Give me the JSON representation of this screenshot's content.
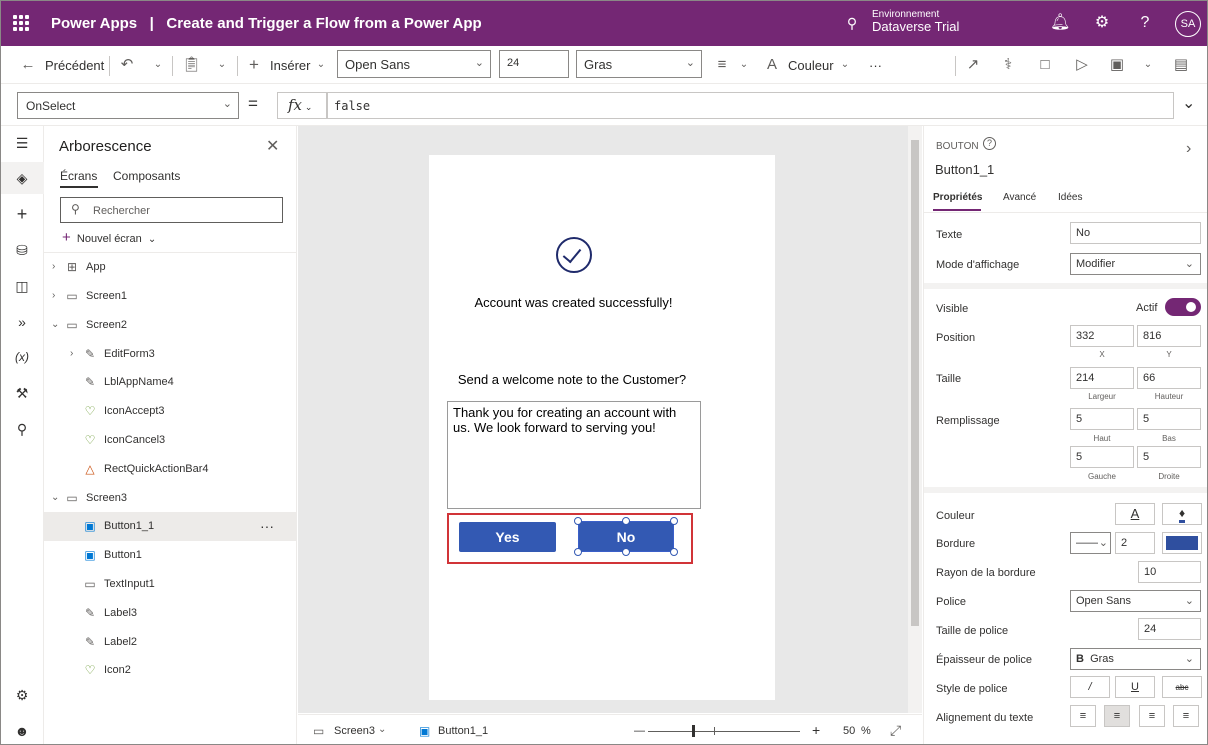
{
  "titlebar": {
    "app_name": "Power Apps",
    "separator": "|",
    "doc_title": "Create and Trigger a Flow from a Power App",
    "env_label": "Environnement",
    "env_name": "Dataverse Trial",
    "avatar": "SA",
    "icons": [
      "waffle-icon",
      "environment-icon",
      "bell-icon",
      "gear-icon",
      "help-icon"
    ]
  },
  "cmdbar": {
    "back_label": "Précédent",
    "insert_label": "Insérer",
    "font_value": "Open Sans",
    "size_value": "24",
    "weight_value": "Gras",
    "color_label": "Couleur",
    "more": "···"
  },
  "formula": {
    "property": "OnSelect",
    "equals": "=",
    "fx": "fx",
    "value": "false"
  },
  "tree": {
    "title": "Arborescence",
    "tab_screens": "Écrans",
    "tab_components": "Composants",
    "search_placeholder": "Rechercher",
    "new_screen": "Nouvel écran",
    "nodes": [
      {
        "label": "App"
      },
      {
        "label": "Screen1"
      },
      {
        "label": "Screen2"
      },
      {
        "label": "EditForm3"
      },
      {
        "label": "LblAppName4"
      },
      {
        "label": "IconAccept3"
      },
      {
        "label": "IconCancel3"
      },
      {
        "label": "RectQuickActionBar4"
      },
      {
        "label": "Screen3"
      },
      {
        "label": "Button1_1"
      },
      {
        "label": "Button1"
      },
      {
        "label": "TextInput1"
      },
      {
        "label": "Label3"
      },
      {
        "label": "Label2"
      },
      {
        "label": "Icon2"
      }
    ]
  },
  "canvas": {
    "success_text": "Account was created successfully!",
    "question_text": "Send a welcome note to the Customer?",
    "note_text": "Thank you for creating an account with us. We look forward to serving you!",
    "yes_label": "Yes",
    "no_label": "No"
  },
  "status": {
    "screen": "Screen3",
    "control": "Button1_1",
    "zoom_minus": "—",
    "zoom_plus": "+",
    "zoom_value": "50",
    "zoom_unit": "%"
  },
  "props": {
    "kind": "BOUTON",
    "name": "Button1_1",
    "tab_properties": "Propriétés",
    "tab_advanced": "Avancé",
    "tab_ideas": "Idées",
    "text_label": "Texte",
    "text_value": "No",
    "display_label": "Mode d'affichage",
    "display_value": "Modifier",
    "visible_label": "Visible",
    "visible_value": "Actif",
    "position_label": "Position",
    "pos_x": "332",
    "pos_y": "816",
    "x_label": "X",
    "y_label": "Y",
    "size_label": "Taille",
    "width": "214",
    "height": "66",
    "width_label": "Largeur",
    "height_label": "Hauteur",
    "padding_label": "Remplissage",
    "pad_top": "5",
    "pad_bottom": "5",
    "pad_left": "5",
    "pad_right": "5",
    "top_label": "Haut",
    "bottom_label": "Bas",
    "left_label": "Gauche",
    "right_label": "Droite",
    "color_label": "Couleur",
    "color_a": "A",
    "border_label": "Bordure",
    "border_width": "2",
    "border_color": "#2f4f9f",
    "radius_label": "Rayon de la bordure",
    "radius_value": "10",
    "font_label": "Police",
    "font_value": "Open Sans",
    "font_size_label": "Taille de police",
    "font_size_value": "24",
    "weight_label": "Épaisseur de police",
    "weight_value": "Gras",
    "weight_b": "B",
    "style_label": "Style de police",
    "style_italic": "/",
    "style_underline": "U",
    "style_strike": "abc",
    "align_label": "Alignement du texte"
  },
  "colors": {
    "brand": "#742774",
    "button": "#3359b3",
    "highlight": "#d13438"
  }
}
